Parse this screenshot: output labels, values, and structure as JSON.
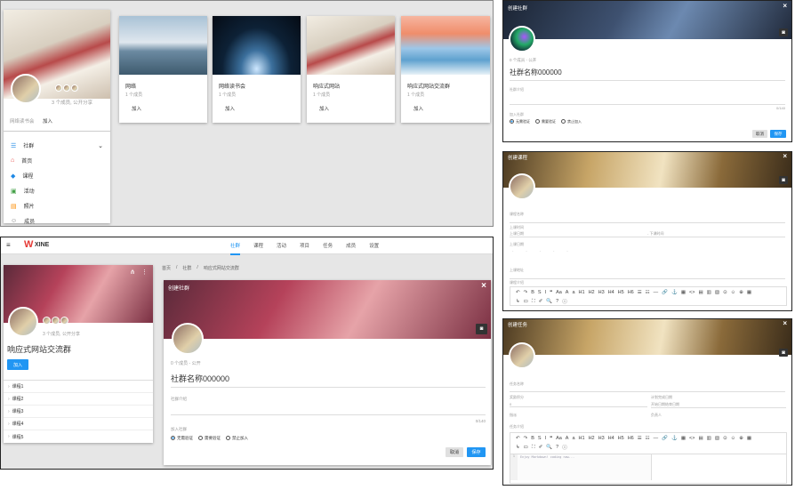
{
  "panel1": {
    "profile_stats": "3 个成员, 公开分享",
    "group_name": "网络读书会",
    "join": "加入",
    "menu": [
      {
        "label": "社群",
        "icon": "list-icon",
        "color": "#1e88e5"
      },
      {
        "label": "首页",
        "icon": "home-icon",
        "color": "#e53935"
      },
      {
        "label": "课程",
        "icon": "layers-icon",
        "color": "#1e88e5"
      },
      {
        "label": "活动",
        "icon": "calendar-icon",
        "color": "#43a047"
      },
      {
        "label": "照片",
        "icon": "image-icon",
        "color": "#fb8c00"
      },
      {
        "label": "成员",
        "icon": "people-icon",
        "color": "#757575"
      }
    ],
    "cards": [
      {
        "title": "网络",
        "members": "1 个成员",
        "action": "加入"
      },
      {
        "title": "网络读书会",
        "members": "1 个成员",
        "action": "加入"
      },
      {
        "title": "响应式网站",
        "members": "1 个成员",
        "action": "加入"
      },
      {
        "title": "响应式网站交流群",
        "members": "1 个成员",
        "action": "加入"
      }
    ]
  },
  "dialog_group": {
    "title": "创建社群",
    "stats": "0 个成员 - 公开",
    "name": "社群名称000000",
    "intro_label": "社群介绍",
    "counter": "0/140",
    "join_label": "加入社群",
    "options": [
      "无需验证",
      "需要验证",
      "禁止加入"
    ],
    "cancel": "取消",
    "save": "保存",
    "close": "×"
  },
  "dialog_course": {
    "title": "创建课程",
    "name_label": "课程名称",
    "time_label": "上课时间",
    "start_placeholder": "上课日期",
    "end_placeholder": "- 下课时间",
    "days_label": "上课日期",
    "days": [
      "-",
      "-",
      "-",
      "-",
      "-"
    ],
    "place_label": "上课地址",
    "intro_label": "课程介绍",
    "close": "×"
  },
  "dialog_task": {
    "title": "创建任务",
    "name_label": "任务名称",
    "score_label": "奖励积分",
    "score_value": "0",
    "deadline_label": "计划完成日期",
    "deadline_placeholder": "开始日期结束日期",
    "join_label": "指派",
    "owner_label": "负责人",
    "intro_label": "任务介绍",
    "editor_text": "Enjoy Markdown! coding now...",
    "close": "×"
  },
  "toolbar_row1": [
    "↶",
    "↷",
    "B",
    "S",
    "I",
    "❝",
    "Aa",
    "A",
    "a",
    "H1",
    "H2",
    "H3",
    "H4",
    "H5",
    "H6",
    "☰",
    "☷",
    "―",
    "🔗",
    "⚓",
    "▦",
    "<>",
    "▤",
    "▥",
    "▧",
    "⊙",
    "☺",
    "⊕",
    "▦"
  ],
  "toolbar_row2": [
    "↳",
    "▭",
    "⛶",
    "✐",
    "🔍",
    "?",
    "ⓘ"
  ],
  "app": {
    "brand": "XINE",
    "tabs": [
      "社群",
      "课程",
      "活动",
      "项目",
      "任务",
      "成员",
      "设置"
    ],
    "breadcrumb": [
      "首页",
      "社群",
      "响应式网站交流群"
    ],
    "profile_stats": "3 个成员, 公开分享",
    "group_title": "响应式网站交流群",
    "join": "加入",
    "courses": [
      "课程1",
      "课程2",
      "课程3",
      "课程4",
      "课程5"
    ],
    "dialog": {
      "title": "创建社群",
      "stats": "0 个成员 - 公开",
      "name": "社群名称000000",
      "intro_label": "社群介绍",
      "counter": "0/140",
      "join_label": "加入社群",
      "options": [
        "无需验证",
        "需要验证",
        "禁止加入"
      ],
      "cancel": "取消",
      "save": "保存",
      "close": "×"
    }
  },
  "colors": {
    "accent": "#2196f3",
    "brand": "#e53935",
    "bg": "#e0e0e0"
  }
}
